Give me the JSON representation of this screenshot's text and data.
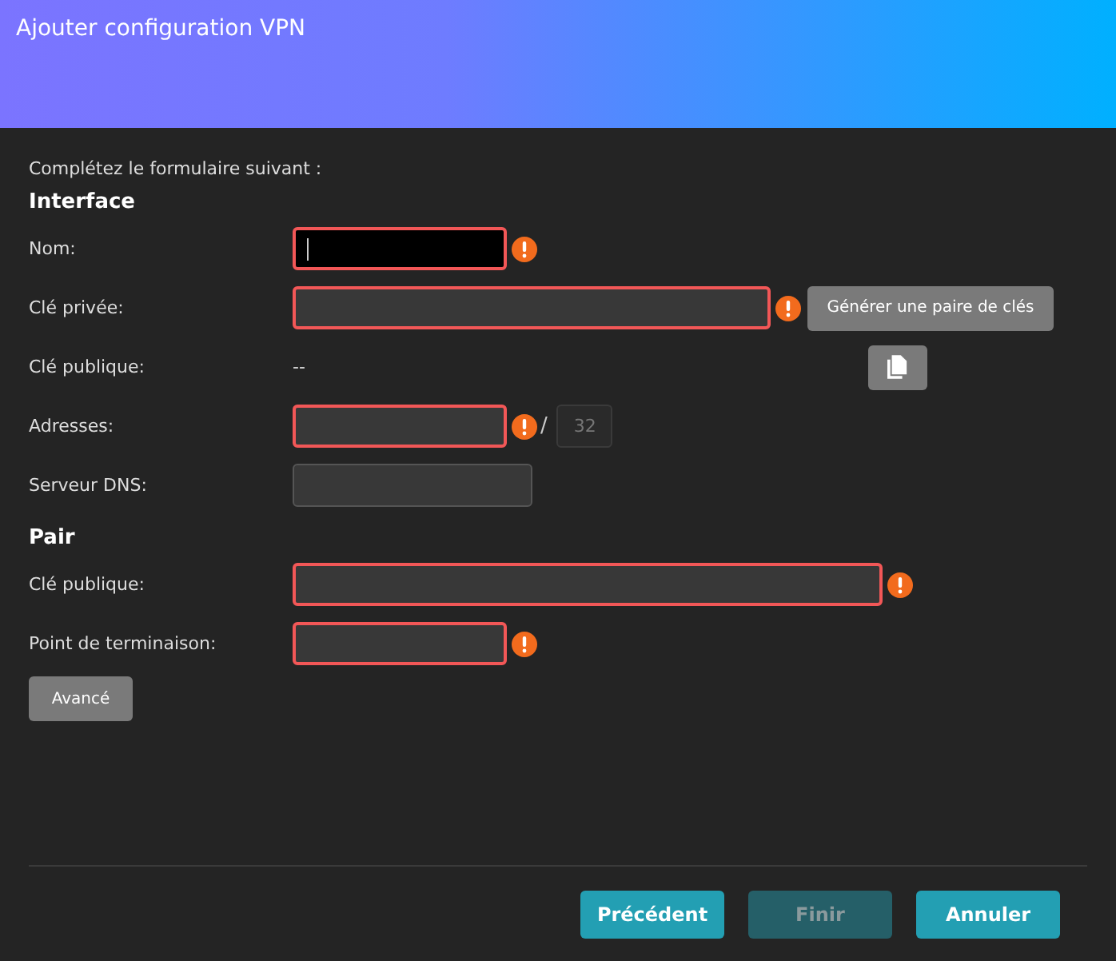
{
  "window": {
    "title": "Ajouter configuration VPN"
  },
  "intro": "Complétez le formulaire suivant :",
  "sections": [
    {
      "heading": "Interface",
      "rows": [
        {
          "label": "Nom:",
          "kind": "short-input",
          "invalid": true,
          "focused": true
        },
        {
          "label": "Clé privée:",
          "kind": "long-input",
          "invalid": true,
          "focused": false,
          "button": "Générer une paire de clés"
        },
        {
          "label": "Clé publique:",
          "kind": "text",
          "value": "--",
          "copy_button": true
        },
        {
          "label": "Adresses:",
          "kind": "address-input",
          "invalid": true,
          "focused": false,
          "separator": "/",
          "prefix": {
            "value": "32",
            "disabled": true
          }
        },
        {
          "label": "Serveur DNS:",
          "kind": "dns-input",
          "invalid": false,
          "focused": false
        }
      ]
    },
    {
      "heading": "Pair",
      "rows": [
        {
          "label": "Clé publique:",
          "kind": "wide-input",
          "invalid": true,
          "focused": false
        },
        {
          "label": "Point de terminaison:",
          "kind": "short-input",
          "invalid": true,
          "focused": false
        }
      ]
    }
  ],
  "advanced_button": {
    "label": "Avancé"
  },
  "footer_buttons": [
    {
      "label": "Précédent",
      "disabled": false
    },
    {
      "label": "Finir",
      "disabled": true
    },
    {
      "label": "Annuler",
      "disabled": false
    }
  ]
}
